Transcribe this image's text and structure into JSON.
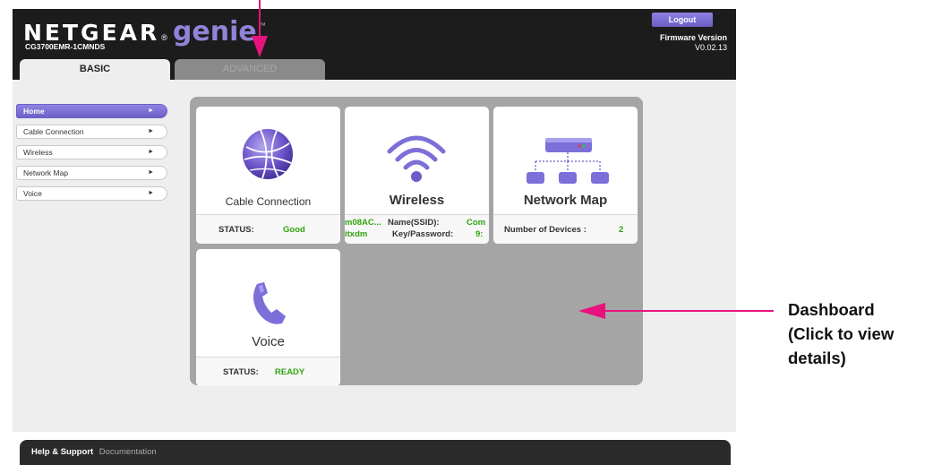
{
  "header": {
    "brand_main": "NETGEAR",
    "brand_reg": "®",
    "brand_genie": "genie",
    "brand_tm": "™",
    "model": "CG3700EMR-1CMNDS",
    "logout_label": "Logout",
    "firmware_label": "Firmware Version",
    "firmware_value": "V0.02.13"
  },
  "tabs": [
    {
      "label": "BASIC",
      "active": true
    },
    {
      "label": "ADVANCED",
      "active": false
    }
  ],
  "sidebar": {
    "items": [
      {
        "label": "Home",
        "active": true
      },
      {
        "label": "Cable Connection",
        "active": false
      },
      {
        "label": "Wireless",
        "active": false
      },
      {
        "label": "Network Map",
        "active": false
      },
      {
        "label": "Voice",
        "active": false
      }
    ],
    "arrow": "►"
  },
  "dashboard": {
    "cable": {
      "title": "Cable Connection",
      "status_label": "STATUS:",
      "status_value": "Good"
    },
    "wireless": {
      "title": "Wireless",
      "line1_left": "m08AC...",
      "line1_label": "Name(SSID):",
      "line1_value": "Com",
      "line2_left": "itxdm",
      "line2_label": "Key/Password:",
      "line2_value": "9:"
    },
    "network": {
      "title": "Network Map",
      "devices_label": "Number of Devices :",
      "devices_value": "2"
    },
    "voice": {
      "title": "Voice",
      "status_label": "STATUS:",
      "status_value": "READY"
    }
  },
  "annotation": {
    "line1": "Dashboard",
    "line2": "(Click to view",
    "line3": "details)"
  },
  "footer": {
    "help_label": "Help & Support",
    "doc_label": "Documentation"
  },
  "colors": {
    "accent": "#7a6ed4",
    "annotation_arrow": "#e8127c",
    "status_green": "#2fa40f"
  },
  "icons": [
    "globe-icon",
    "wifi-icon",
    "router-network-icon",
    "phone-icon",
    "chevron-right-icon"
  ]
}
